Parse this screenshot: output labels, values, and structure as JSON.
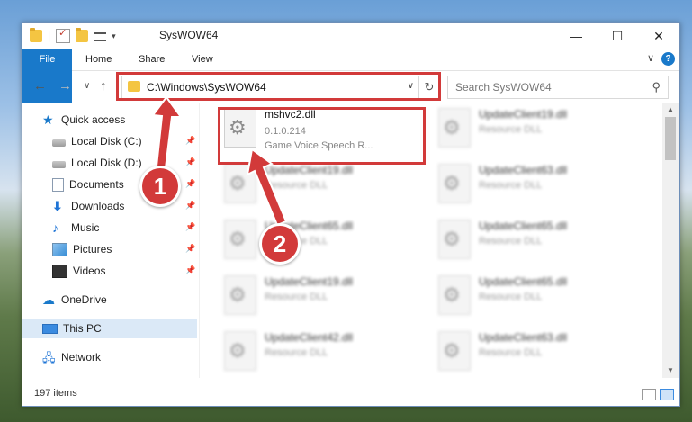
{
  "window": {
    "title": "SysWOW64",
    "minimize_label": "—",
    "maximize_label": "☐",
    "close_label": "✕"
  },
  "ribbon": {
    "tabs": [
      {
        "label": "File"
      },
      {
        "label": "Home"
      },
      {
        "label": "Share"
      },
      {
        "label": "View"
      }
    ],
    "help_label": "?",
    "collapse_label": "∨"
  },
  "address_bar": {
    "path": "C:\\Windows\\SysWOW64",
    "dropdown_label": "∨",
    "refresh_label": "↻"
  },
  "search": {
    "placeholder": "Search SysWOW64",
    "icon_label": "⚲"
  },
  "nav": {
    "back_label": "←",
    "forward_label": "→",
    "recent_label": "∨",
    "up_label": "↑",
    "pin_label": "📌",
    "items": [
      {
        "label": "Quick access",
        "icon": "star-icon"
      },
      {
        "label": "Local Disk (C:)",
        "icon": "local-disk-icon"
      },
      {
        "label": "Local Disk (D:)",
        "icon": "local-disk-icon"
      },
      {
        "label": "Documents",
        "icon": "documents-icon"
      },
      {
        "label": "Downloads",
        "icon": "downloads-icon"
      },
      {
        "label": "Music",
        "icon": "music-icon"
      },
      {
        "label": "Pictures",
        "icon": "pictures-icon"
      },
      {
        "label": "Videos",
        "icon": "videos-icon"
      },
      {
        "label": "OneDrive",
        "icon": "onedrive-icon"
      },
      {
        "label": "This PC",
        "icon": "this-pc-icon"
      },
      {
        "label": "Network",
        "icon": "network-icon"
      }
    ]
  },
  "files": [
    {
      "name": "mshvc2.dll",
      "version": "0.1.0.214",
      "description": "Game Voice Speech R..."
    },
    {
      "name": "UpdateClient19.dll",
      "description": "Resource DLL"
    },
    {
      "name": "UpdateClient19.dll",
      "description": "Resource DLL"
    },
    {
      "name": "UpdateClient63.dll",
      "description": "Resource DLL"
    },
    {
      "name": "UpdateClient65.dll",
      "description": "Resource DLL"
    },
    {
      "name": "UpdateClient65.dll",
      "description": "Resource DLL"
    },
    {
      "name": "UpdateClient19.dll",
      "description": "Resource DLL"
    },
    {
      "name": "UpdateClient65.dll",
      "description": "Resource DLL"
    },
    {
      "name": "UpdateClient42.dll",
      "description": "Resource DLL"
    },
    {
      "name": "UpdateClient63.dll",
      "description": "Resource DLL"
    }
  ],
  "status": {
    "item_count": "197 items"
  },
  "annotations": {
    "marker1": "1",
    "marker2": "2",
    "color": "#d23a3a"
  }
}
